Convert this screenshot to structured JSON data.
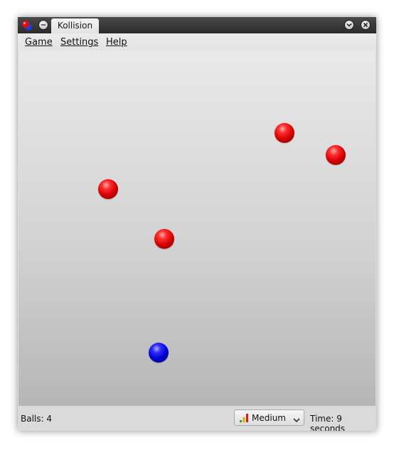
{
  "window": {
    "title": "Kollision"
  },
  "menubar": {
    "items": [
      {
        "label": "Game"
      },
      {
        "label": "Settings"
      },
      {
        "label": "Help"
      }
    ]
  },
  "game": {
    "red_ball_count": 4,
    "blue_ball_count": 1,
    "ball_colors": {
      "red": "#d50000",
      "blue": "#0000d0"
    }
  },
  "statusbar": {
    "balls_text": "Balls: 4",
    "difficulty": "Medium",
    "time_text": "Time: 9 seconds"
  },
  "icons": {
    "app": "kollision-app-icon",
    "window_menu": "window-menu-icon",
    "minimize": "chevron-down-icon",
    "close": "close-icon",
    "difficulty": "difficulty-bars-icon",
    "dropdown": "chevron-down-icon"
  }
}
